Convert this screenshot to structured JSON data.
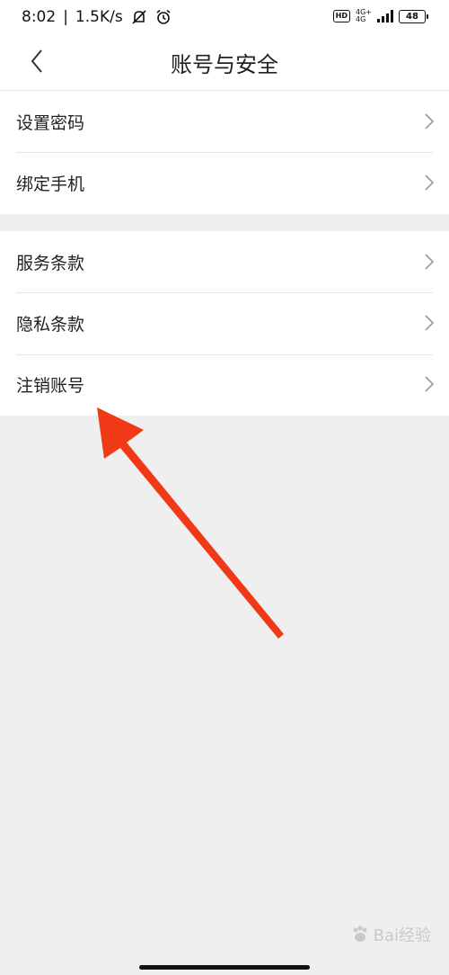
{
  "status_bar": {
    "time": "8:02",
    "separator": "|",
    "speed": "1.5K/s",
    "hd": "HD",
    "network_top": "4G+",
    "network_bottom": "4G",
    "battery": "48"
  },
  "header": {
    "title": "账号与安全"
  },
  "group1": {
    "items": [
      {
        "label": "设置密码"
      },
      {
        "label": "绑定手机"
      }
    ]
  },
  "group2": {
    "items": [
      {
        "label": "服务条款"
      },
      {
        "label": "隐私条款"
      },
      {
        "label": "注销账号"
      }
    ]
  },
  "watermark": {
    "text": "Bai经验"
  },
  "colors": {
    "annotation_arrow": "#f03a17",
    "background": "#efefef"
  }
}
